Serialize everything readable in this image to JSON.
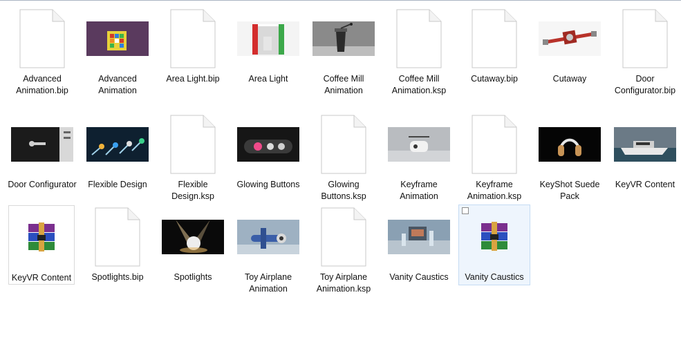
{
  "items": [
    {
      "label": "Advanced Animation.bip",
      "type": "doc"
    },
    {
      "label": "Advanced Animation",
      "type": "img",
      "preview": "rubiks-cube-icon"
    },
    {
      "label": "Area Light.bip",
      "type": "doc"
    },
    {
      "label": "Area Light",
      "type": "img",
      "preview": "area-light-box-icon"
    },
    {
      "label": "Coffee Mill Animation",
      "type": "img",
      "preview": "coffee-mill-icon"
    },
    {
      "label": "Coffee Mill Animation.ksp",
      "type": "doc"
    },
    {
      "label": "Cutaway.bip",
      "type": "doc"
    },
    {
      "label": "Cutaway",
      "type": "img",
      "preview": "cutaway-valve-icon"
    },
    {
      "label": "Door Configurator.bip",
      "type": "doc"
    },
    {
      "label": "Door Configurator",
      "type": "img",
      "preview": "door-handle-icon"
    },
    {
      "label": "Flexible Design",
      "type": "img",
      "preview": "flexible-design-icon"
    },
    {
      "label": "Flexible Design.ksp",
      "type": "doc"
    },
    {
      "label": "Glowing Buttons",
      "type": "img",
      "preview": "glowing-buttons-icon"
    },
    {
      "label": "Glowing Buttons.ksp",
      "type": "doc"
    },
    {
      "label": "Keyframe Animation",
      "type": "img",
      "preview": "keyframe-drone-icon"
    },
    {
      "label": "Keyframe Animation.ksp",
      "type": "doc"
    },
    {
      "label": "KeyShot Suede Pack",
      "type": "img",
      "preview": "headphones-icon"
    },
    {
      "label": "KeyVR Content",
      "type": "img",
      "preview": "boat-icon"
    },
    {
      "label": "KeyVR Content",
      "type": "rar"
    },
    {
      "label": "Spotlights.bip",
      "type": "doc"
    },
    {
      "label": "Spotlights",
      "type": "img",
      "preview": "spotlights-ball-icon"
    },
    {
      "label": "Toy Airplane Animation",
      "type": "img",
      "preview": "toy-airplane-icon"
    },
    {
      "label": "Toy Airplane Animation.ksp",
      "type": "doc"
    },
    {
      "label": "Vanity Caustics",
      "type": "img",
      "preview": "vanity-caustics-icon"
    },
    {
      "label": "Vanity Caustics",
      "type": "rar",
      "selected": true
    }
  ]
}
